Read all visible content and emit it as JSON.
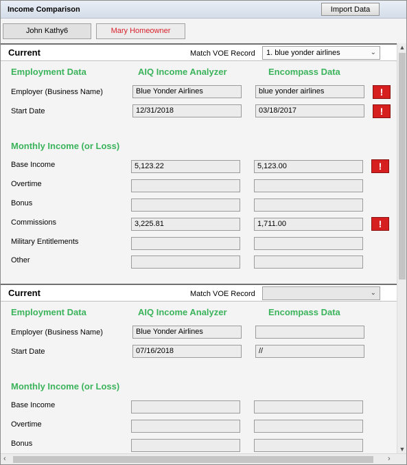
{
  "window": {
    "title": "Income Comparison",
    "import_label": "Import Data"
  },
  "tabs": [
    {
      "label": "John Kathy6"
    },
    {
      "label": "Mary Homeowner"
    }
  ],
  "sections": [
    {
      "title": "Current",
      "voe_label": "Match VOE Record",
      "voe_value": "1. blue yonder airlines",
      "employment_heading": "Employment Data",
      "aiq_heading": "AIQ Income Analyzer",
      "encompass_heading": "Encompass Data",
      "employer_label": "Employer (Business Name)",
      "employer_aiq": "Blue Yonder Airlines",
      "employer_encompass": "blue yonder airlines",
      "start_label": "Start Date",
      "start_aiq": "12/31/2018",
      "start_encompass": "03/18/2017",
      "monthly_heading": "Monthly Income (or Loss)",
      "income": [
        {
          "label": "Base Income",
          "aiq": "5,123.22",
          "encompass": "5,123.00"
        },
        {
          "label": "Overtime",
          "aiq": "",
          "encompass": ""
        },
        {
          "label": "Bonus",
          "aiq": "",
          "encompass": ""
        },
        {
          "label": "Commissions",
          "aiq": "3,225.81",
          "encompass": "1,711.00"
        },
        {
          "label": "Military Entitlements",
          "aiq": "",
          "encompass": ""
        },
        {
          "label": "Other",
          "aiq": "",
          "encompass": ""
        }
      ],
      "alert_symbol": "!"
    },
    {
      "title": "Current",
      "voe_label": "Match VOE Record",
      "voe_value": "",
      "employment_heading": "Employment Data",
      "aiq_heading": "AIQ Income Analyzer",
      "encompass_heading": "Encompass Data",
      "employer_label": "Employer (Business Name)",
      "employer_aiq": "Blue Yonder Airlines",
      "employer_encompass": "",
      "start_label": "Start Date",
      "start_aiq": "07/16/2018",
      "start_encompass": "//",
      "monthly_heading": "Monthly Income (or Loss)",
      "income": [
        {
          "label": "Base Income",
          "aiq": "",
          "encompass": ""
        },
        {
          "label": "Overtime",
          "aiq": "",
          "encompass": ""
        },
        {
          "label": "Bonus",
          "aiq": "",
          "encompass": ""
        }
      ]
    }
  ],
  "colors": {
    "heading_green": "#3bb35b",
    "alert_red": "#d61f1f",
    "tab_red_text": "#d9202a"
  },
  "icons": {
    "dropdown": "chevron-down-icon",
    "alert": "exclamation-icon",
    "scroll_up": "caret-up-icon",
    "scroll_down": "caret-down-icon",
    "scroll_left": "caret-left-icon",
    "scroll_right": "caret-right-icon"
  }
}
